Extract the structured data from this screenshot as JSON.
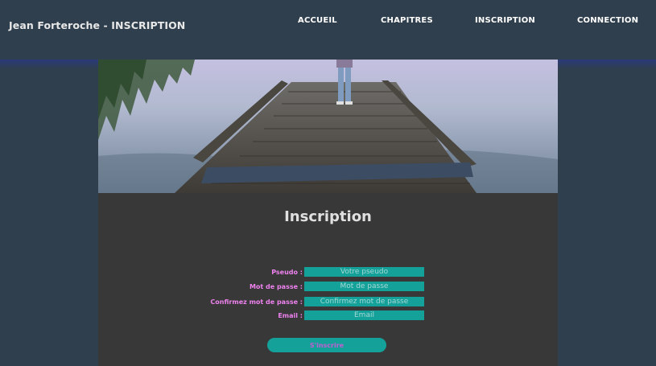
{
  "header": {
    "brand": "Jean Forteroche - INSCRIPTION",
    "nav": [
      "ACCUEIL",
      "CHAPITRES",
      "INSCRIPTION",
      "CONNECTION"
    ]
  },
  "hero": {
    "image": "wooden-pier-lake-photo"
  },
  "form": {
    "title": "Inscription",
    "fields": [
      {
        "label": "Pseudo :",
        "placeholder": "Votre pseudo"
      },
      {
        "label": "Mot de passe :",
        "placeholder": "Mot de passe"
      },
      {
        "label": "Confirmez mot de passe :",
        "placeholder": "Confirmez mot de passe"
      },
      {
        "label": "Email :",
        "placeholder": "Email"
      }
    ],
    "submit": "S'inscrire"
  },
  "colors": {
    "background": "#2f3f4d",
    "panel": "#383838",
    "accent": "#14a19a",
    "label": "#ee82ee"
  }
}
